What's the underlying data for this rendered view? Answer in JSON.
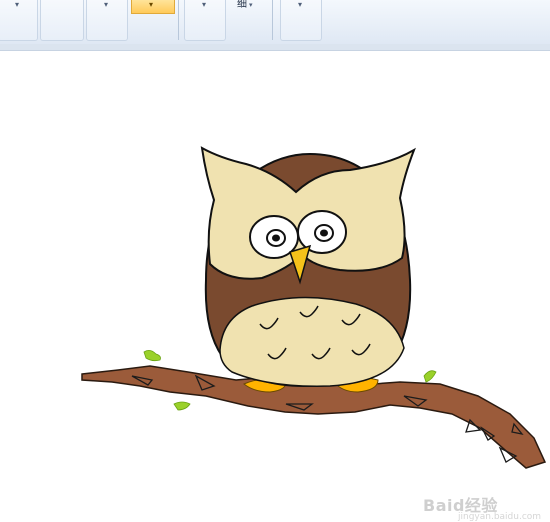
{
  "toolbar": {
    "group1_caret": "▾",
    "group2_caret": "▾",
    "active_caret": "▾",
    "group4_caret": "▾",
    "thin_label": "细",
    "thin_caret": "▾",
    "group6_caret": "▾"
  },
  "canvas": {
    "subject": "owl-on-branch-drawing",
    "colors": {
      "owl_light": "#f0e2b0",
      "owl_dark": "#7a4a2f",
      "branch": "#9b5b3a",
      "beak": "#f5c21a",
      "feet": "#ffb300",
      "leaf": "#9ad12a"
    }
  },
  "watermark": {
    "text": "Baid经验",
    "sub": "jingyan.baidu.com"
  }
}
